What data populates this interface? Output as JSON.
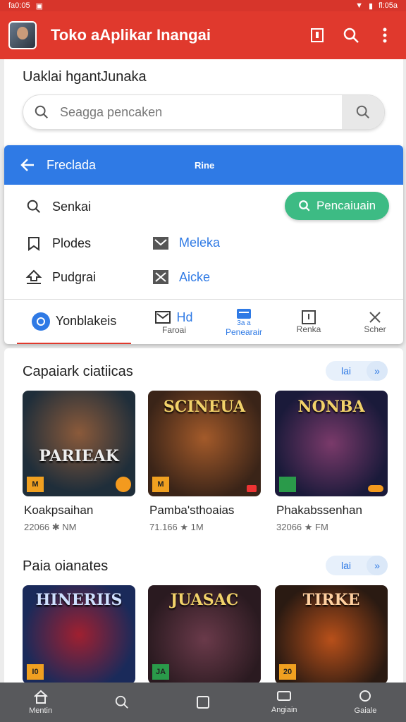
{
  "statusbar": {
    "left": "fa0:05",
    "right": "fl:05a"
  },
  "appbar": {
    "title": "Toko aAplikar Inangai"
  },
  "greeting": "Uaklai hgantJunaka",
  "search": {
    "placeholder": "Seagga pencaken"
  },
  "panel": {
    "back_label": "Freclada",
    "tag": "Rine",
    "menu": [
      {
        "label": "Senkai",
        "icon": "search-icon"
      },
      {
        "label": "Plodes",
        "icon": "bookmark-icon"
      },
      {
        "label": "Pudgrai",
        "icon": "upload-icon"
      }
    ],
    "links": [
      {
        "label": "Meleka",
        "icon": "mail-icon"
      },
      {
        "label": "Aicke",
        "icon": "tools-icon"
      }
    ],
    "pill_label": "Pencaiuain",
    "tabs": [
      {
        "label": "Yonblakeis"
      },
      {
        "big": "Hd",
        "label": "Faroai"
      },
      {
        "label": "Penearair",
        "badge": "3a a"
      },
      {
        "label": "Renka"
      },
      {
        "label": "Scher"
      }
    ]
  },
  "sections": [
    {
      "title": "Capaiark ciatiicas",
      "button": "lai",
      "games": [
        {
          "name": "Koakpsaihan",
          "meta": "22066 ✱ NM",
          "logo": "PARIEAK",
          "badge": "M"
        },
        {
          "name": "Pamba'sthoaias",
          "meta": "71.166 ★ 1M",
          "logo": "SCINEUA",
          "badge": "M"
        },
        {
          "name": "Phakabssenhan",
          "meta": "32066 ★ FM",
          "logo": "NONBA",
          "badge": ""
        }
      ]
    },
    {
      "title": "Paia oianates",
      "button": "lai",
      "games": [
        {
          "logo": "HINERIIS",
          "badge": "I0"
        },
        {
          "logo": "JUASAC",
          "badge": "JA"
        },
        {
          "logo": "TIRKE",
          "badge": "20"
        }
      ]
    }
  ],
  "navbar": [
    {
      "label": "Mentin",
      "icon": "home-icon"
    },
    {
      "label": "",
      "icon": "search-icon"
    },
    {
      "label": "",
      "icon": "square-icon"
    },
    {
      "label": "Angiain",
      "icon": "chat-icon"
    },
    {
      "label": "Gaiale",
      "icon": "profile-icon"
    }
  ],
  "colors": {
    "brand": "#e0392d",
    "accent": "#2f7ae5",
    "success": "#3dbb84"
  }
}
